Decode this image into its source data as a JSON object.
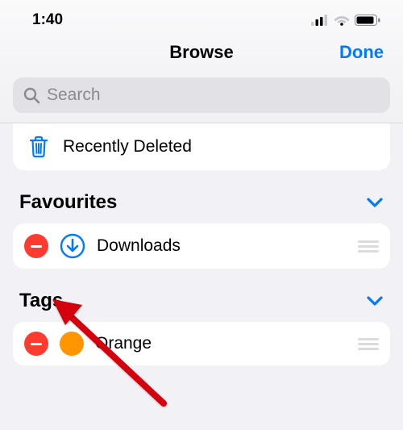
{
  "status": {
    "time": "1:40"
  },
  "header": {
    "title": "Browse",
    "done_label": "Done"
  },
  "search": {
    "placeholder": "Search"
  },
  "recently_deleted": {
    "label": "Recently Deleted"
  },
  "sections": {
    "favourites": {
      "title": "Favourites",
      "items": [
        {
          "label": "Downloads",
          "icon": "download-circle"
        }
      ]
    },
    "tags": {
      "title": "Tags",
      "items": [
        {
          "label": "Orange",
          "color": "#ff9500"
        }
      ]
    }
  },
  "colors": {
    "accent": "#007aff",
    "destructive": "#ff3b30"
  }
}
